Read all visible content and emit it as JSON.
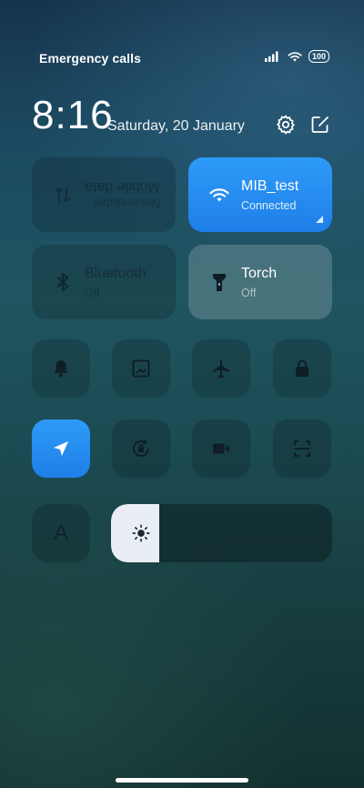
{
  "status_bar": {
    "carrier_text": "Emergency calls",
    "battery": "100"
  },
  "header": {
    "time": "8:16",
    "date": "Saturday, 20 January"
  },
  "tiles": {
    "mobile_data": {
      "title": "Mobile data",
      "subtitle": "Not available",
      "state": "disabled",
      "icon": "data-arrows-icon"
    },
    "wifi": {
      "title": "MIB_test",
      "subtitle": "Connected",
      "state": "on",
      "icon": "wifi-icon"
    },
    "bluetooth": {
      "title": "Bluetooth",
      "subtitle": "Off",
      "state": "off",
      "icon": "bluetooth-icon"
    },
    "torch": {
      "title": "Torch",
      "subtitle": "Off",
      "state": "off",
      "icon": "flashlight-icon"
    }
  },
  "toggles": [
    {
      "name": "bell-icon",
      "state": "off"
    },
    {
      "name": "screenshot-icon",
      "state": "off"
    },
    {
      "name": "airplane-icon",
      "state": "off"
    },
    {
      "name": "lock-icon",
      "state": "off"
    },
    {
      "name": "location-icon",
      "state": "on"
    },
    {
      "name": "rotation-lock-icon",
      "state": "off"
    },
    {
      "name": "video-camera-icon",
      "state": "off"
    },
    {
      "name": "scan-icon",
      "state": "off"
    }
  ],
  "font_button": {
    "label": "A"
  },
  "brightness": {
    "level": 0.22
  },
  "colors": {
    "accent": "#2589f0",
    "tile_dim": "rgba(0,0,0,0.16)"
  }
}
